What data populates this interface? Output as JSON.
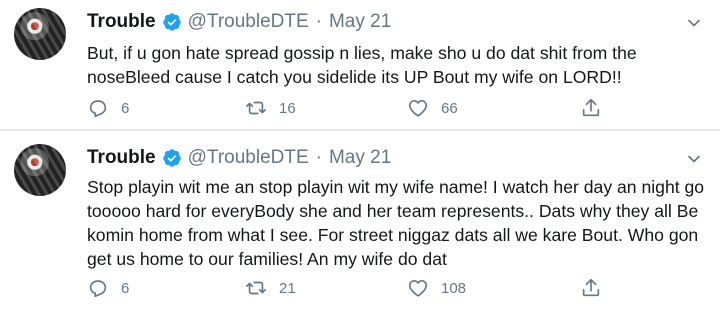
{
  "tweets": [
    {
      "display_name": "Trouble",
      "handle": "@TroubleDTE",
      "separator": "·",
      "date": "May 21",
      "text": "But, if u gon hate spread gossip n lies, make sho u do dat shit from the noseBleed cause I catch you sidelide its UP Bout my wife on LORD!!",
      "replies": "6",
      "retweets": "16",
      "likes": "66"
    },
    {
      "display_name": "Trouble",
      "handle": "@TroubleDTE",
      "separator": "·",
      "date": "May 21",
      "text": "Stop playin wit me an stop playin wit my wife name! I watch her day an night go tooooo hard for everyBody she and her team represents.. Dats why they all Be komin home from what I see. For street niggaz dats all we kare Bout. Who gon get us home to our families! An my wife do dat",
      "replies": "6",
      "retweets": "21",
      "likes": "108"
    }
  ],
  "icons": {
    "verified": "verified-badge-icon",
    "caret": "chevron-down-icon",
    "reply": "reply-icon",
    "retweet": "retweet-icon",
    "like": "heart-icon",
    "share": "share-icon"
  },
  "colors": {
    "text": "#14171a",
    "secondary": "#657786",
    "verified": "#1da1f2",
    "divider": "#e6ecf0"
  }
}
